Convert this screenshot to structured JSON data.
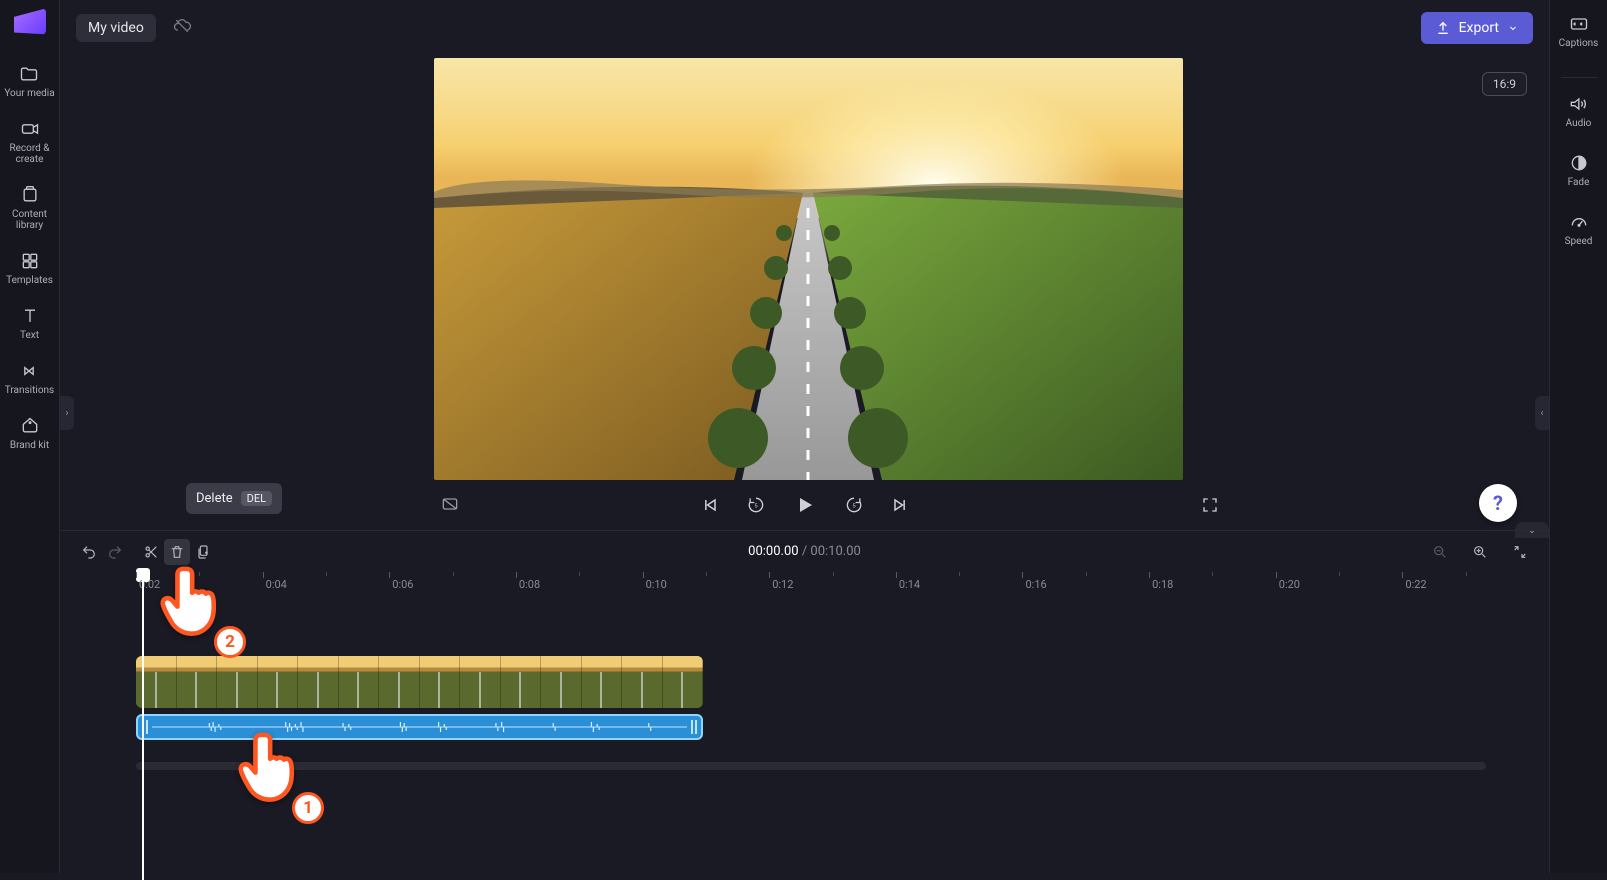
{
  "header": {
    "title": "My video",
    "export_label": "Export"
  },
  "left_sidebar": {
    "items": [
      {
        "label": "Your media"
      },
      {
        "label": "Record & create"
      },
      {
        "label": "Content library"
      },
      {
        "label": "Templates"
      },
      {
        "label": "Text"
      },
      {
        "label": "Transitions"
      },
      {
        "label": "Brand kit"
      }
    ]
  },
  "right_sidebar": {
    "items": [
      {
        "label": "Captions"
      },
      {
        "label": "Audio"
      },
      {
        "label": "Fade"
      },
      {
        "label": "Speed"
      }
    ]
  },
  "preview": {
    "aspect_ratio": "16:9"
  },
  "timeline": {
    "current_time": "00:00.00",
    "duration": "00:10.00",
    "ruler_first": "0",
    "ruler_marks": [
      "0:02",
      "0:04",
      "0:06",
      "0:08",
      "0:10",
      "0:12",
      "0:14",
      "0:16",
      "0:18",
      "0:20",
      "0:22"
    ]
  },
  "tooltip": {
    "label": "Delete",
    "shortcut": "DEL"
  },
  "annotations": {
    "step1": "1",
    "step2": "2"
  },
  "help_label": "?"
}
